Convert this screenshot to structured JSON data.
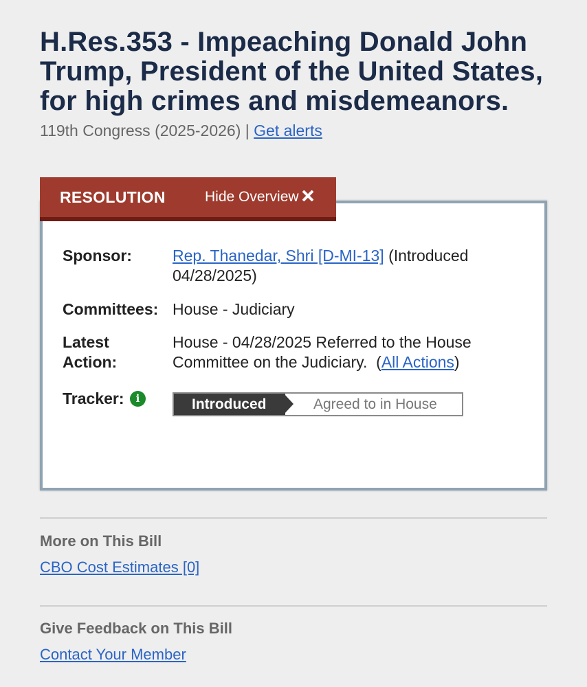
{
  "bill": {
    "title": "H.Res.353 - Impeaching Donald John Trump, President of the United States, for high crimes and misdemeanors.",
    "congress": "119th Congress (2025-2026)",
    "separator": "|",
    "get_alerts": "Get alerts"
  },
  "overview": {
    "type_label": "RESOLUTION",
    "hide_overview": "Hide Overview",
    "sponsor_label": "Sponsor:",
    "sponsor_name": "Rep. Thanedar, Shri [D-MI-13]",
    "sponsor_introduced": "(Introduced 04/28/2025)",
    "committees_label": "Committees:",
    "committees_value": "House - Judiciary",
    "latest_action_label": "Latest Action:",
    "latest_action_text": "House - 04/28/2025 Referred to the House Committee on the Judiciary.",
    "all_actions_link": "All Actions",
    "tracker_label": "Tracker:",
    "tracker_info_icon": "info-circle-icon",
    "tracker_steps": [
      "Introduced",
      "Agreed to in House"
    ],
    "tracker_current_step": "Introduced"
  },
  "more": {
    "heading": "More on This Bill",
    "link": "CBO Cost Estimates [0]"
  },
  "feedback": {
    "heading": "Give Feedback on This Bill",
    "link": "Contact Your Member"
  },
  "colors": {
    "background": "#eeeeee",
    "title": "#1b2b48",
    "tab": "#9e3b2e",
    "link": "#2a64c5",
    "tracker_active": "#3a3a3a",
    "info_icon": "#1a8a2a"
  }
}
